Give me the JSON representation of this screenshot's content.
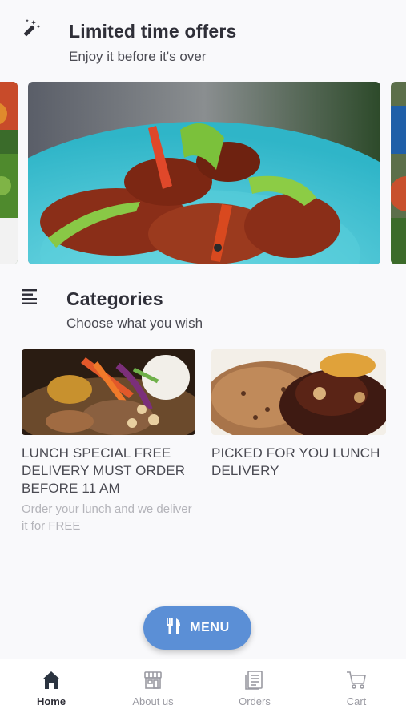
{
  "offers": {
    "icon": "magic-wand-icon",
    "title": "Limited time offers",
    "subtitle": "Enjoy it before it's over"
  },
  "categories": {
    "icon": "list-icon",
    "title": "Categories",
    "subtitle": "Choose what you wish",
    "items": [
      {
        "title": "LUNCH SPECIAL FREE DELIVERY MUST ORDER BEFORE 11 AM",
        "description": "Order your lunch and we deliver it for FREE"
      },
      {
        "title": "PICKED FOR YOU LUNCH DELIVERY",
        "description": ""
      }
    ]
  },
  "menu_button": {
    "icon": "fork-knife-icon",
    "label": "MENU"
  },
  "bottom_nav": {
    "active": "Home",
    "items": [
      {
        "label": "Home",
        "icon": "home-icon"
      },
      {
        "label": "About us",
        "icon": "store-icon"
      },
      {
        "label": "Orders",
        "icon": "receipt-icon"
      },
      {
        "label": "Cart",
        "icon": "cart-icon"
      }
    ]
  },
  "colors": {
    "accent": "#5b8fd6",
    "background": "#f9f9fb",
    "text": "#2d2d36",
    "muted": "#b4b4ba"
  }
}
